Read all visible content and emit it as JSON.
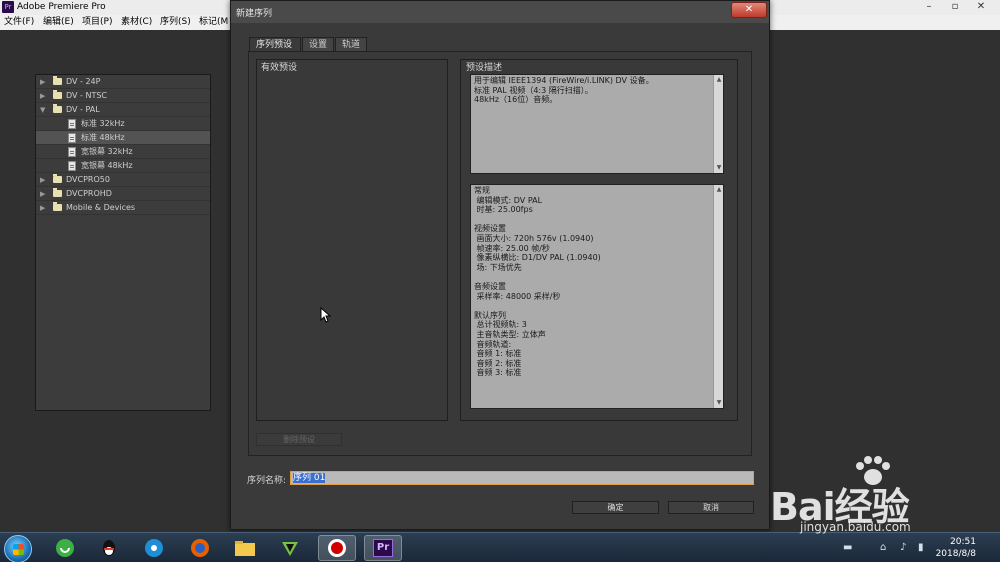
{
  "app": {
    "title": "Adobe Premiere Pro",
    "menu": [
      "文件(F)",
      "编辑(E)",
      "项目(P)",
      "素材(C)",
      "序列(S)",
      "标记(M"
    ]
  },
  "dialog": {
    "title": "新建序列",
    "close": "✕",
    "tabs": [
      "序列预设",
      "设置",
      "轨道"
    ],
    "available_presets_title": "有效预设",
    "preset_desc_title": "预设描述",
    "tree": [
      {
        "label": "DV - 24P",
        "type": "folder",
        "expanded": false
      },
      {
        "label": "DV - NTSC",
        "type": "folder",
        "expanded": false
      },
      {
        "label": "DV - PAL",
        "type": "folder",
        "expanded": true
      },
      {
        "label": "标准 32kHz",
        "type": "preset"
      },
      {
        "label": "标准 48kHz",
        "type": "preset",
        "selected": true
      },
      {
        "label": "宽银幕 32kHz",
        "type": "preset"
      },
      {
        "label": "宽银幕 48kHz",
        "type": "preset"
      },
      {
        "label": "DVCPRO50",
        "type": "folder",
        "expanded": false
      },
      {
        "label": "DVCPROHD",
        "type": "folder",
        "expanded": false
      },
      {
        "label": "Mobile & Devices",
        "type": "folder",
        "expanded": false
      }
    ],
    "description_lines": [
      "用于编辑 IEEE1394 (FireWire/i.LINK) DV 设备。",
      "标准 PAL 视频（4:3 隔行扫描）。",
      "48kHz（16位）音频。"
    ],
    "details_lines": [
      "常规",
      " 编辑模式: DV PAL",
      " 时基: 25.00fps",
      "",
      "视频设置",
      " 画面大小: 720h 576v (1.0940)",
      " 帧速率: 25.00 帧/秒",
      " 像素纵横比: D1/DV PAL (1.0940)",
      " 场: 下场优先",
      "",
      "音频设置",
      " 采样率: 48000 采样/秒",
      "",
      "默认序列",
      " 总计视频轨: 3",
      " 主音轨类型: 立体声",
      " 音频轨道:",
      " 音频 1: 标准",
      " 音频 2: 标准",
      " 音频 3: 标准"
    ],
    "delete_preset": "删除预设",
    "sequence_name_label": "序列名称:",
    "sequence_name_value": "序列 01",
    "ok": "确定",
    "cancel": "取消"
  },
  "taskbar": {
    "time": "20:51",
    "date": "2018/8/8",
    "pr_label": "Pr"
  },
  "watermark": {
    "text": "Bai经验",
    "url": "jingyan.baidu.com"
  }
}
